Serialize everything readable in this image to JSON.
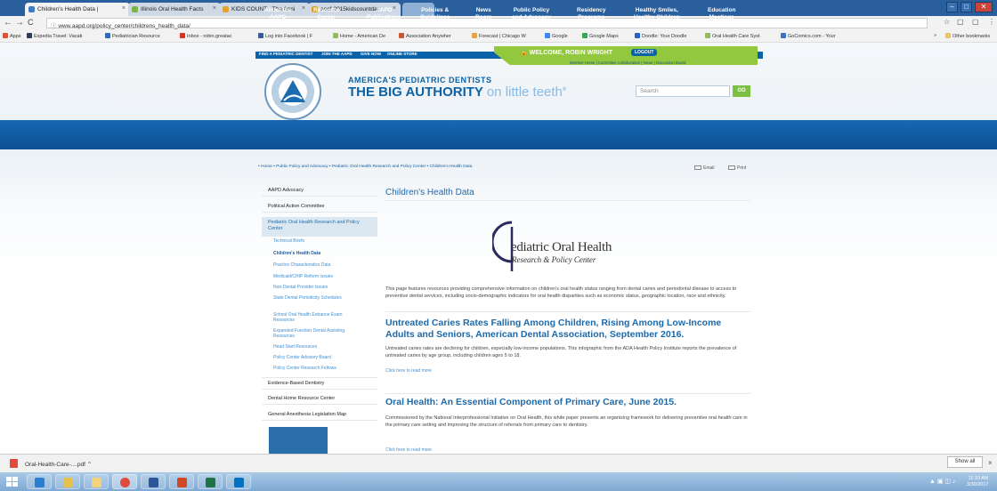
{
  "browser": {
    "tabs": [
      {
        "label": "Children's Health Data |",
        "color": "#3f7cc1"
      },
      {
        "label": "Illinois Oral Health Facts",
        "color": "#7fb34a"
      },
      {
        "label": "KIDS COUNT - The Anni",
        "color": "#e3a232"
      },
      {
        "label": "aecf-2015kidscountdat",
        "color": "#d9a02c"
      }
    ],
    "url": "www.aapd.org/policy_center/childrens_health_data/",
    "bookmarks": [
      {
        "label": "Apps",
        "color": "#e4502e"
      },
      {
        "label": "Expedia Travel: Vacati",
        "color": "#2d3a5a"
      },
      {
        "label": "Pediatrician Resource",
        "color": "#2a6fb4"
      },
      {
        "label": "Inbox - robin.greatac",
        "color": "#d93025"
      },
      {
        "label": "Log into Facebook | F",
        "color": "#3b5998"
      },
      {
        "label": "Home - American De",
        "color": "#8fbf5a"
      },
      {
        "label": "Association Anywher",
        "color": "#c75b2b"
      },
      {
        "label": "Forecast | Chicago W",
        "color": "#e9a33a"
      },
      {
        "label": "Google",
        "color": "#4285f4"
      },
      {
        "label": "Google Maps",
        "color": "#34a853"
      },
      {
        "label": "Doodle: Your Doodle",
        "color": "#2266cc"
      },
      {
        "label": "Oral Health Care Syst",
        "color": "#8fbf5a"
      },
      {
        "label": "GoComics.com - Your",
        "color": "#3a74c9"
      }
    ],
    "other_bookmarks": "Other bookmarks",
    "more_bookmarks": "»"
  },
  "site": {
    "topnav": [
      "FIND A PEDIATRIC DENTIST",
      "JOIN THE AAPD",
      "GIVE NOW",
      "ONLINE STORE"
    ],
    "welcome": "WELCOME, ROBIN WRIGHT",
    "logout": "LOGOUT",
    "member_links": "Member Home | Committee Collaboration | News | Discussion Board",
    "org_name": "AMERICA'S PEDIATRIC DENTISTS",
    "tagline_bold": "THE BIG AUTHORITY",
    "tagline_light": "on little teeth",
    "tagline_mark": "®",
    "search_placeholder": "Search",
    "search_go": "GO",
    "main_nav": [
      {
        "label": "About the\nAAPD"
      },
      {
        "label": "Resource\nCenter"
      },
      {
        "label": "AAPD\nPublications"
      },
      {
        "label": "Policies &\nGuidelines"
      },
      {
        "label": "News\nRoom"
      },
      {
        "label": "Public Policy\nand Advocacy"
      },
      {
        "label": "Residency\nPrograms"
      },
      {
        "label": "Healthy Smiles,\nHealthy Children"
      },
      {
        "label": "Education\nMeetings"
      }
    ],
    "breadcrumb": "• Home   • Public Policy and Advocacy   • Pediatric Oral Health Research and Policy Center   • Children's Health Data",
    "email_label": "Email",
    "print_label": "Print"
  },
  "sidebar": {
    "items": [
      "AAPD Advocacy",
      "Political Action Committee"
    ],
    "highlighted": "Pediatric Oral Health Research and Policy Center",
    "subitems": [
      "Technical Briefs",
      "Children's Health Data",
      "Practice Characteristics Data",
      "Medicaid/CHIP Reform Issues",
      "Non-Dental Provider Issues",
      "State Dental Periodicity Schedules",
      "School Oral Health Entrance Exam Resources",
      "Expanded Function Dental Assisting Resources",
      "Head Start Resources",
      "Policy Center Advisory Board",
      "Policy Center Research Fellows"
    ],
    "bottom_items": [
      "Evidence-Based Dentistry",
      "Dental Home Resource Center",
      "General Anesthesia Legislation Map"
    ]
  },
  "main": {
    "title": "Children's Health Data",
    "center_logo_name": "ediatric Oral Health",
    "center_logo_sub": "Research & Policy Center",
    "intro": "This page features resources providing comprehensive information on children's oral health status ranging from dental caries and periodontal disease to access to preventive dental services, including socio-demographic indicators for oral health disparities such as economic status, geographic location, race and ethnicity.",
    "articles": [
      {
        "heading": "Untreated Caries Rates Falling Among Children, Rising Among Low-Income Adults and Seniors, American Dental Association, September 2016.",
        "body": "Untreated caries rates are declining for children, especially low-income populations. This infographic from the ADA Health Policy Institute reports the prevalence of untreated caries by age group, including children ages 5 to 18.",
        "more": "Click here to read more"
      },
      {
        "heading": "Oral Health: An Essential Component of Primary Care, June 2015.",
        "body": "Commissioned by the National Interprofessional Initiative on Oral Health, this white paper presents an organizing framework for delivering preventive oral health care in the primary care setting and improving the structure of referrals from primary care to dentistry.",
        "more": "Click here to read more"
      }
    ]
  },
  "downloads": {
    "file": "Oral-Health-Care-....pdf",
    "show_all": "Show all"
  },
  "taskbar": {
    "apps": [
      {
        "icon": "ie-icon",
        "color": "#2a7fd4"
      },
      {
        "icon": "file-explorer-icon",
        "color": "#e7c24a"
      },
      {
        "icon": "chrome-icon",
        "color": "#e04a3b"
      },
      {
        "icon": "word-icon",
        "color": "#2b579a"
      },
      {
        "icon": "powerpoint-icon",
        "color": "#d24726"
      },
      {
        "icon": "excel-icon",
        "color": "#217346"
      },
      {
        "icon": "outlook-icon",
        "color": "#0072c6"
      }
    ],
    "time": "11:10 AM",
    "date": "3/30/2017"
  }
}
